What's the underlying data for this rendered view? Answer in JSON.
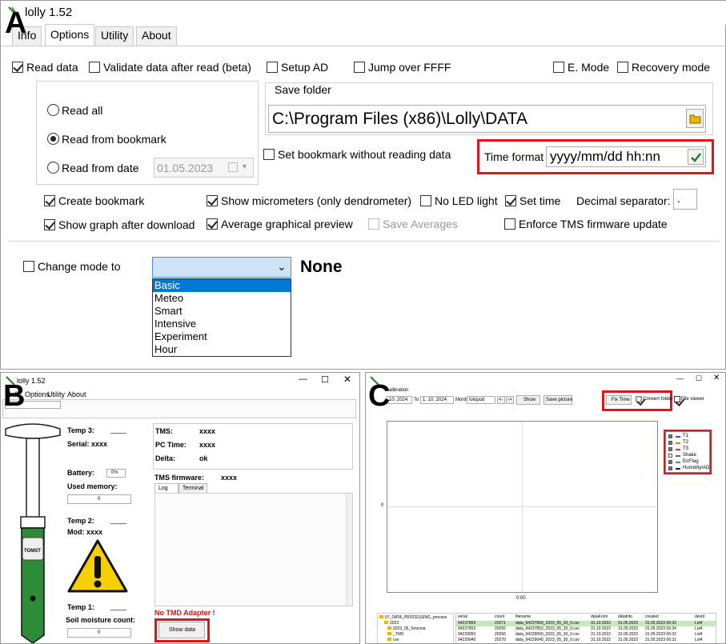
{
  "panel_labels": {
    "a": "A",
    "b": "B",
    "c": "C"
  },
  "panel_a": {
    "window_title": "lolly 1.52",
    "tabs": [
      "Info",
      "Options",
      "Utility",
      "About"
    ],
    "active_tab": "Options",
    "read_data": "Read data",
    "validate_data": "Validate data after read (beta)",
    "setup_ad": "Setup AD",
    "jump_over": "Jump over FFFF",
    "e_mode": "E. Mode",
    "recovery_mode": "Recovery mode",
    "read_all": "Read all",
    "read_from_bookmark": "Read from bookmark",
    "read_from_date": "Read from date",
    "read_from_date_value": "01.05.2023",
    "save_folder_label": "Save folder",
    "save_folder_path": "C:\\Program Files (x86)\\Lolly\\DATA",
    "set_bookmark": "Set bookmark without reading data",
    "time_format_label": "Time format",
    "time_format_value": "yyyy/mm/dd hh:nn",
    "create_bookmark": "Create bookmark",
    "show_micrometers": "Show micrometers (only dendrometer)",
    "no_led": "No LED light",
    "set_time": "Set time",
    "decimal_separator": "Decimal separator:",
    "decimal_separator_value": ".",
    "show_graph": "Show graph after download",
    "average_preview": "Average graphical preview",
    "save_averages": "Save Averages",
    "enforce_tms": "Enforce TMS firmware update",
    "change_mode": "Change mode to",
    "mode_current": "None",
    "mode_options": [
      "Basic",
      "Meteo",
      "Smart",
      "Intensive",
      "Experiment",
      "Hour"
    ]
  },
  "panel_b": {
    "window_title": "lolly 1.52",
    "tabs": [
      "Info",
      "Options",
      "Utility",
      "About"
    ],
    "temp3": "Temp 3:",
    "temp3_val": "____",
    "serial": "Serial: xxxx",
    "battery": "Battery:",
    "battery_val": "0%",
    "used_memory": "Used memory:",
    "used_memory_val": "0",
    "temp2": "Temp 2:",
    "temp2_val": "____",
    "mod": "Mod: xxxx",
    "temp1": "Temp 1:",
    "temp1_val": "____",
    "soil_moisture": "Soil moisture count:",
    "soil_moisture_val": "0",
    "tms": "TMS:",
    "tms_val": "xxxx",
    "pc_time": "PC Time:",
    "pc_time_val": "xxxx",
    "delta": "Delta:",
    "delta_val": "ok",
    "tms_firmware": "TMS firmware:",
    "tms_firmware_val": "xxxx",
    "log_tab": "Log",
    "terminal_tab": "Terminal",
    "no_adapter": "No TMD Adapter !",
    "show_data": "Show data",
    "logo_text": "TOMST"
  },
  "panel_c": {
    "header": "calibration",
    "from_date": "10. 2024",
    "to_label": "To",
    "to_date": "1. 10. 2024",
    "month_label": "Month",
    "month_value": "lolopod",
    "nav_prev": "<-",
    "nav_next": "->",
    "show_btn": "Show",
    "save_picture": "Save picture",
    "fix_time": "Fix Time",
    "convert_folder": "Convert folder",
    "file_viewer": "File viewer",
    "y_axis_zero": "0",
    "x_axis_zero": "0:00",
    "legend": [
      "T1",
      "T2",
      "T3",
      "Shake",
      "ErrFlag",
      "Humidity/AD"
    ],
    "legend_colors": [
      "#3355cc",
      "#cc8800",
      "#cc3333",
      "#666666",
      "#339966",
      "#222222"
    ],
    "folders": [
      "07_DATA_PROCESSING_process",
      "2023",
      "2023_05_Smrcina",
      "_TMS",
      "csv"
    ],
    "table_headers": [
      "serial",
      "count",
      "filename",
      "dataFrom",
      "dataInto",
      "created",
      "devId"
    ],
    "table_rows": [
      [
        "94237869",
        "20271",
        "data_94237869_2023_05_30_0.csv",
        "31.10.2022",
        "31.05.2023",
        "31.05.2023 06:33",
        "Lol4"
      ],
      [
        "94237853",
        "20255",
        "data_94237853_2023_05_30_0.csv",
        "31.10.2022",
        "31.05.2023",
        "31.05.2023 06:34",
        "Lol4"
      ],
      [
        "94229050",
        "20256",
        "data_94229050_2023_05_30_0.csv",
        "31.10.2022",
        "31.05.2023",
        "31.05.2023 06:32",
        "Lol4"
      ],
      [
        "94229040",
        "20270",
        "data_94229040_2023_05_30_0.csv",
        "31.10.2022",
        "31.05.2023",
        "31.05.2023 06:31",
        "Lol4"
      ]
    ]
  }
}
